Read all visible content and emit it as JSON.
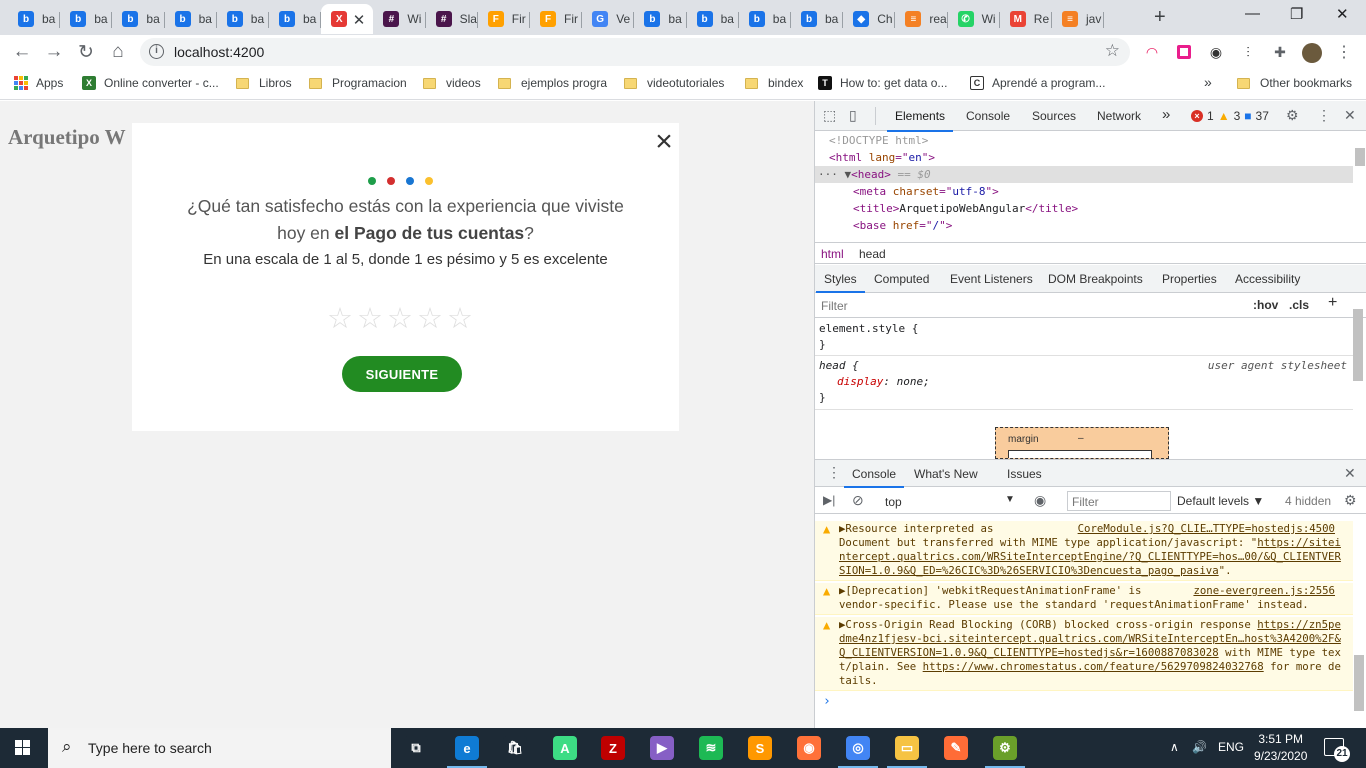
{
  "tabs": [
    {
      "title": "ba",
      "icon": "bootstrap-icon",
      "color": "#1a73e8",
      "glyph": "b"
    },
    {
      "title": "ba",
      "icon": "bootstrap-icon",
      "color": "#1a73e8",
      "glyph": "b"
    },
    {
      "title": "ba",
      "icon": "bootstrap-icon",
      "color": "#1a73e8",
      "glyph": "b"
    },
    {
      "title": "ba",
      "icon": "bootstrap-icon",
      "color": "#1a73e8",
      "glyph": "b"
    },
    {
      "title": "ba",
      "icon": "bootstrap-icon",
      "color": "#1a73e8",
      "glyph": "b"
    },
    {
      "title": "ba",
      "icon": "bootstrap-icon",
      "color": "#1a73e8",
      "glyph": "b"
    },
    {
      "title": "",
      "icon": "colorful-x-icon",
      "color": "#e53935",
      "glyph": "X",
      "active": true
    },
    {
      "title": "Wi",
      "icon": "slack-icon",
      "color": "#4a154b",
      "glyph": "#"
    },
    {
      "title": "Sla",
      "icon": "slack-icon",
      "color": "#4a154b",
      "glyph": "#"
    },
    {
      "title": "Fir",
      "icon": "firebase-icon",
      "color": "#ffa000",
      "glyph": "F"
    },
    {
      "title": "Fir",
      "icon": "firebase-icon",
      "color": "#ffa000",
      "glyph": "F"
    },
    {
      "title": "Ve",
      "icon": "google-icon",
      "color": "#4285f4",
      "glyph": "G"
    },
    {
      "title": "ba",
      "icon": "bootstrap-icon",
      "color": "#1a73e8",
      "glyph": "b"
    },
    {
      "title": "ba",
      "icon": "bootstrap-icon",
      "color": "#1a73e8",
      "glyph": "b"
    },
    {
      "title": "ba",
      "icon": "bootstrap-icon",
      "color": "#1a73e8",
      "glyph": "b"
    },
    {
      "title": "ba",
      "icon": "bootstrap-icon",
      "color": "#1a73e8",
      "glyph": "b"
    },
    {
      "title": "Ch",
      "icon": "diamond-icon",
      "color": "#1a73e8",
      "glyph": "◆"
    },
    {
      "title": "rea",
      "icon": "stack-icon",
      "color": "#f48024",
      "glyph": "≡"
    },
    {
      "title": "Wi",
      "icon": "whatsapp-icon",
      "color": "#25d366",
      "glyph": "✆"
    },
    {
      "title": "Re",
      "icon": "gmail-icon",
      "color": "#ea4335",
      "glyph": "M"
    },
    {
      "title": "jav",
      "icon": "stack-icon",
      "color": "#f48024",
      "glyph": "≡"
    }
  ],
  "omnibox": {
    "url": "localhost:4200"
  },
  "bookmarks": [
    {
      "label": "Apps",
      "kind": "apps"
    },
    {
      "label": "Online converter - c...",
      "kind": "site",
      "color": "#2e7d32",
      "glyph": "X"
    },
    {
      "label": "Libros",
      "kind": "folder"
    },
    {
      "label": "Programacion",
      "kind": "folder"
    },
    {
      "label": "videos",
      "kind": "folder"
    },
    {
      "label": "ejemplos progra",
      "kind": "folder"
    },
    {
      "label": "videotutoriales",
      "kind": "folder"
    },
    {
      "label": "bindex",
      "kind": "folder"
    },
    {
      "label": "How to: get data o...",
      "kind": "site",
      "color": "#111111",
      "glyph": "T"
    },
    {
      "label": "Aprendé a program...",
      "kind": "site",
      "color": "#ffffff",
      "glyph": "C"
    }
  ],
  "bookmarks_more": "»",
  "other_bookmarks": "Other bookmarks",
  "page": {
    "title": "Arquetipo W",
    "survey": {
      "close": "×",
      "dot_colors": [
        "#1e9e4a",
        "#d32f2f",
        "#1976d2",
        "#fbc02d"
      ],
      "question_line1": "¿Qué tan satisfecho estás con la experiencia que viviste",
      "question_line2_pre": "hoy en ",
      "question_line2_bold": "el Pago de tus cuentas",
      "question_line2_post": "?",
      "scale": "En una escala de 1 al 5, donde 1 es pésimo y 5 es excelente",
      "rating": 0,
      "max_rating": 5,
      "next_button": "SIGUIENTE"
    }
  },
  "devtools": {
    "tabs": [
      "Elements",
      "Console",
      "Sources",
      "Network"
    ],
    "more": "»",
    "errors": "1",
    "warnings": "3",
    "messages": "37",
    "elements": {
      "l1": "<!DOCTYPE html>",
      "l2_tag": "<html",
      "l2_attr": " lang",
      "l2_eq": "=\"",
      "l2_val": "en",
      "l2_end": "\">",
      "l3_tag": "<head>",
      "l3_suffix": " == $0",
      "l4_tag": "<meta",
      "l4_attr": " charset",
      "l4_val": "utf-8",
      "l5_open": "<title>",
      "l5_text": "ArquetipoWebAngular",
      "l5_close": "</title>",
      "l6_tag": "<base",
      "l6_attr": " href",
      "l6_val": "/"
    },
    "breadcrumbs": [
      "html",
      "head"
    ],
    "subtabs": [
      "Styles",
      "Computed",
      "Event Listeners",
      "DOM Breakpoints",
      "Properties",
      "Accessibility"
    ],
    "filter_placeholder": "Filter",
    "hov": ":hov",
    "cls": ".cls",
    "styles": {
      "element_style": "element.style {",
      "close": "}",
      "rule_selector": "head {",
      "rule_origin": "user agent stylesheet",
      "rule_prop": "display",
      "rule_val": "none;"
    },
    "box_model": {
      "label": "margin",
      "value": "–"
    },
    "drawer_tabs": [
      "Console",
      "What's New",
      "Issues"
    ],
    "console": {
      "context": "top",
      "filter_placeholder": "Filter",
      "levels": "Default levels ▼",
      "hidden": "4 hidden",
      "messages": [
        {
          "text_a": "▶Resource interpreted as",
          "source": "CoreModule.js?Q_CLIE…TTYPE=hostedjs:4500",
          "text_b": "Document but transferred with MIME type application/javascript: \"",
          "link": "https://siteintercept.qualtrics.com/WRSiteInterceptEngine/?Q_CLIENTTYPE=hos…00/&Q_CLIENTVERSION=1.0.9&Q_ED=%26CIC%3D%26SERVICIO%3Dencuesta_pago_pasiva",
          "text_c": "\"."
        },
        {
          "text_a": "▶[Deprecation] 'webkitRequestAnimationFrame' is",
          "source": "zone-evergreen.js:2556",
          "text_b": "vendor-specific. Please use the standard 'requestAnimationFrame' instead."
        },
        {
          "text_a": "▶Cross-Origin Read Blocking (CORB) blocked cross-origin response ",
          "link": "https://zn5pedme4nz1fjesv-bci.siteintercept.qualtrics.com/WRSiteInterceptEn…host%3A4200%2F&Q_CLIENTVERSION=1.0.9&Q_CLIENTTYPE=hostedjs&r=1600887083028",
          "text_b": " with MIME type text/plain. See ",
          "link2": "https://www.chromestatus.com/feature/5629709824032768",
          "text_c": " for more details."
        }
      ],
      "prompt": "›"
    }
  },
  "taskbar": {
    "search_placeholder": "Type here to search",
    "language": "ENG",
    "time": "3:51 PM",
    "date": "9/23/2020",
    "notifications": "21",
    "apps": [
      {
        "name": "task-view-icon",
        "color": "#1d2a36",
        "glyph": "⧉"
      },
      {
        "name": "edge-icon",
        "color": "#0f7bd4",
        "glyph": "e"
      },
      {
        "name": "store-icon",
        "color": "#1d2a36",
        "glyph": "🛍"
      },
      {
        "name": "android-studio-icon",
        "color": "#3ddc84",
        "glyph": "A"
      },
      {
        "name": "filezilla-icon",
        "color": "#bf0000",
        "glyph": "Z"
      },
      {
        "name": "visual-studio-icon",
        "color": "#865fc5",
        "glyph": "▶"
      },
      {
        "name": "spotify-icon",
        "color": "#1db954",
        "glyph": "≋"
      },
      {
        "name": "sublime-icon",
        "color": "#ff9800",
        "glyph": "S"
      },
      {
        "name": "firefox-icon",
        "color": "#ff7139",
        "glyph": "◉"
      },
      {
        "name": "chrome-icon",
        "color": "#4285f4",
        "glyph": "◎"
      },
      {
        "name": "explorer-icon",
        "color": "#f6c343",
        "glyph": "▭"
      },
      {
        "name": "postman-icon",
        "color": "#ff6c37",
        "glyph": "✎"
      },
      {
        "name": "android-app-icon",
        "color": "#6a9f2a",
        "glyph": "⚙"
      }
    ]
  }
}
